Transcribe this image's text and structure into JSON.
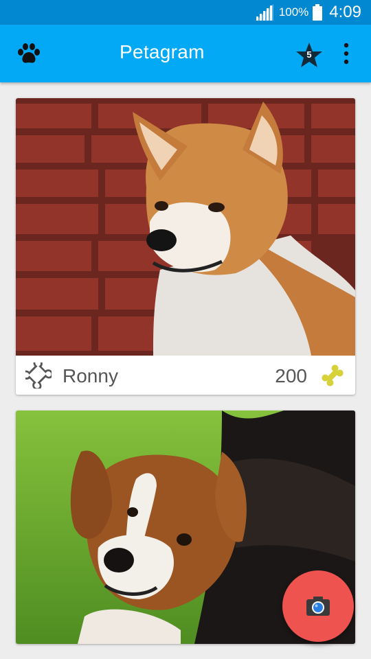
{
  "status_bar": {
    "battery_percent": "100%",
    "time": "4:09",
    "signal_icon": "signal-icon",
    "battery_icon": "battery-icon"
  },
  "app_bar": {
    "title": "Petagram",
    "favorites_badge": "5",
    "icons": [
      "paw-icon",
      "star-icon",
      "overflow-menu-icon"
    ],
    "color": "#03a9f4"
  },
  "pets": [
    {
      "name": "Ronny",
      "rating": "200",
      "photo": "shiba-inu-brick-wall"
    },
    {
      "name": "",
      "rating": "",
      "photo": "collie-mix-grass"
    }
  ],
  "fab": {
    "icon": "camera-icon",
    "color": "#ef5350"
  }
}
